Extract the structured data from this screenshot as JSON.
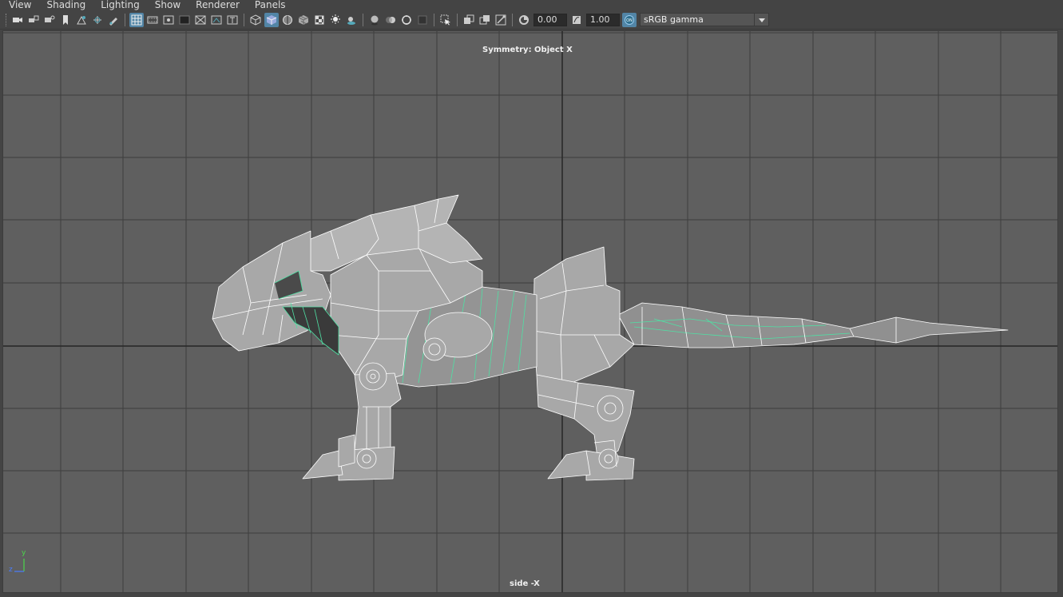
{
  "menu": {
    "items": [
      "View",
      "Shading",
      "Lighting",
      "Show",
      "Renderer",
      "Panels"
    ]
  },
  "toolbar": {
    "exposure_value": "0.00",
    "gamma_value": "1.00",
    "color_space": "sRGB gamma",
    "icons": [
      "camera-icon",
      "camera-attr-icon",
      "bookmark-icon",
      "image-plane-icon",
      "grid-toggle-icon",
      "film-gate-icon",
      "resolution-gate-icon",
      "gate-mask-icon",
      "field-chart-icon",
      "safe-action-icon",
      "safe-title-icon",
      "wireframe-icon",
      "smooth-shade-icon",
      "wireframe-on-shaded-icon",
      "textured-icon",
      "use-lights-icon",
      "shadows-icon",
      "screen-space-ao-icon",
      "motion-blur-icon",
      "anti-alias-icon",
      "depth-of-field-icon",
      "isolate-select-icon",
      "xray-icon",
      "xray-joints-icon",
      "backface-cull-icon",
      "exposure-icon",
      "gamma-icon",
      "color-management-icon"
    ]
  },
  "viewport": {
    "symmetry_label": "Symmetry: Object X",
    "camera_label": "side -X",
    "axis_y": "y",
    "axis_z": "z",
    "colors": {
      "background": "#5f5f5f",
      "grid": "#3e3e3e",
      "axis_line": "#222222",
      "mesh_fill": "#a8a8a8",
      "mesh_wire": "#ffffff",
      "selected_wire": "#4fe0a4"
    }
  }
}
